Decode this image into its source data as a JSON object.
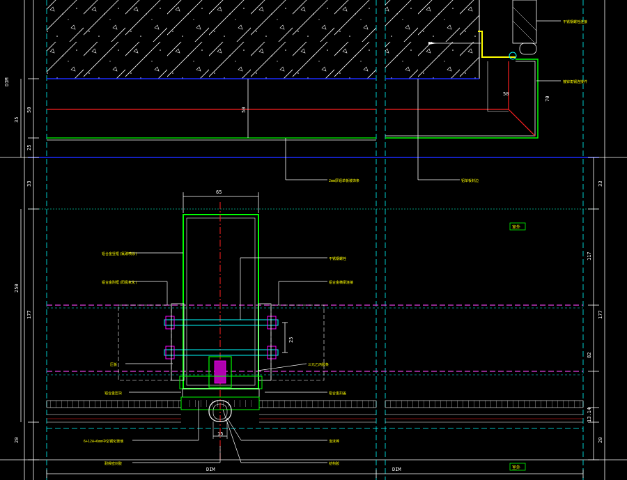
{
  "colors": {
    "background": "#000000",
    "frame": "#FFFFFF",
    "dimension": "#FFFFFF",
    "grid_line": "#00FFFF",
    "profile": "#00FF00",
    "axis": "#FF2020",
    "level": "#1A2BFF",
    "magenta": "#E040E0",
    "leader_text": "#FFFF00",
    "gasket": "#FF00FF",
    "hatch": "#FFFFFF"
  },
  "dimensions": {
    "left_total_top": "DIM",
    "left_35": "35",
    "left_50": "50",
    "left_25": "25",
    "left_33": "33",
    "left_250": "250",
    "left_177": "177",
    "left_20": "20",
    "right_33": "33",
    "right_117": "117",
    "right_177": "177",
    "right_82": "82",
    "right_small": "13.14",
    "right_20": "20",
    "slab_50": "50",
    "angle_50": "50",
    "angle_70": "70",
    "mullion_65": "65",
    "bolt_25": "25",
    "gasket_15": "15",
    "bottom_left": "DIM",
    "bottom_right": "DIM"
  },
  "labels": {
    "slab_top_right": "不锈钢螺栓连接",
    "angle_right": "镀锌角钢连接件",
    "ceiling_bottom": "2mm厚铝单板装饰条",
    "ceiling_right": "铝单板封边",
    "outdoor_tag_top": "室外",
    "outdoor_tag_bottom": "室外",
    "mullion_left_1": "铝合金竖框(氟碳喷涂)",
    "mullion_left_2": "铝合金附框(阳极氧化)",
    "mullion_right_1": "不锈钢螺栓",
    "mullion_right_2": "铝合金横梁连接",
    "pressure_left": "压板",
    "pressure_left_2": "铝合金压块",
    "pressure_right": "三元乙丙胶条",
    "pressure_right_2": "铝合金扣盖",
    "glass_spec": "6+12A+6mm中空钢化玻璃",
    "sealant_left": "耐候密封胶",
    "sealant_right": "结构胶",
    "foam_right": "泡沫棒"
  }
}
